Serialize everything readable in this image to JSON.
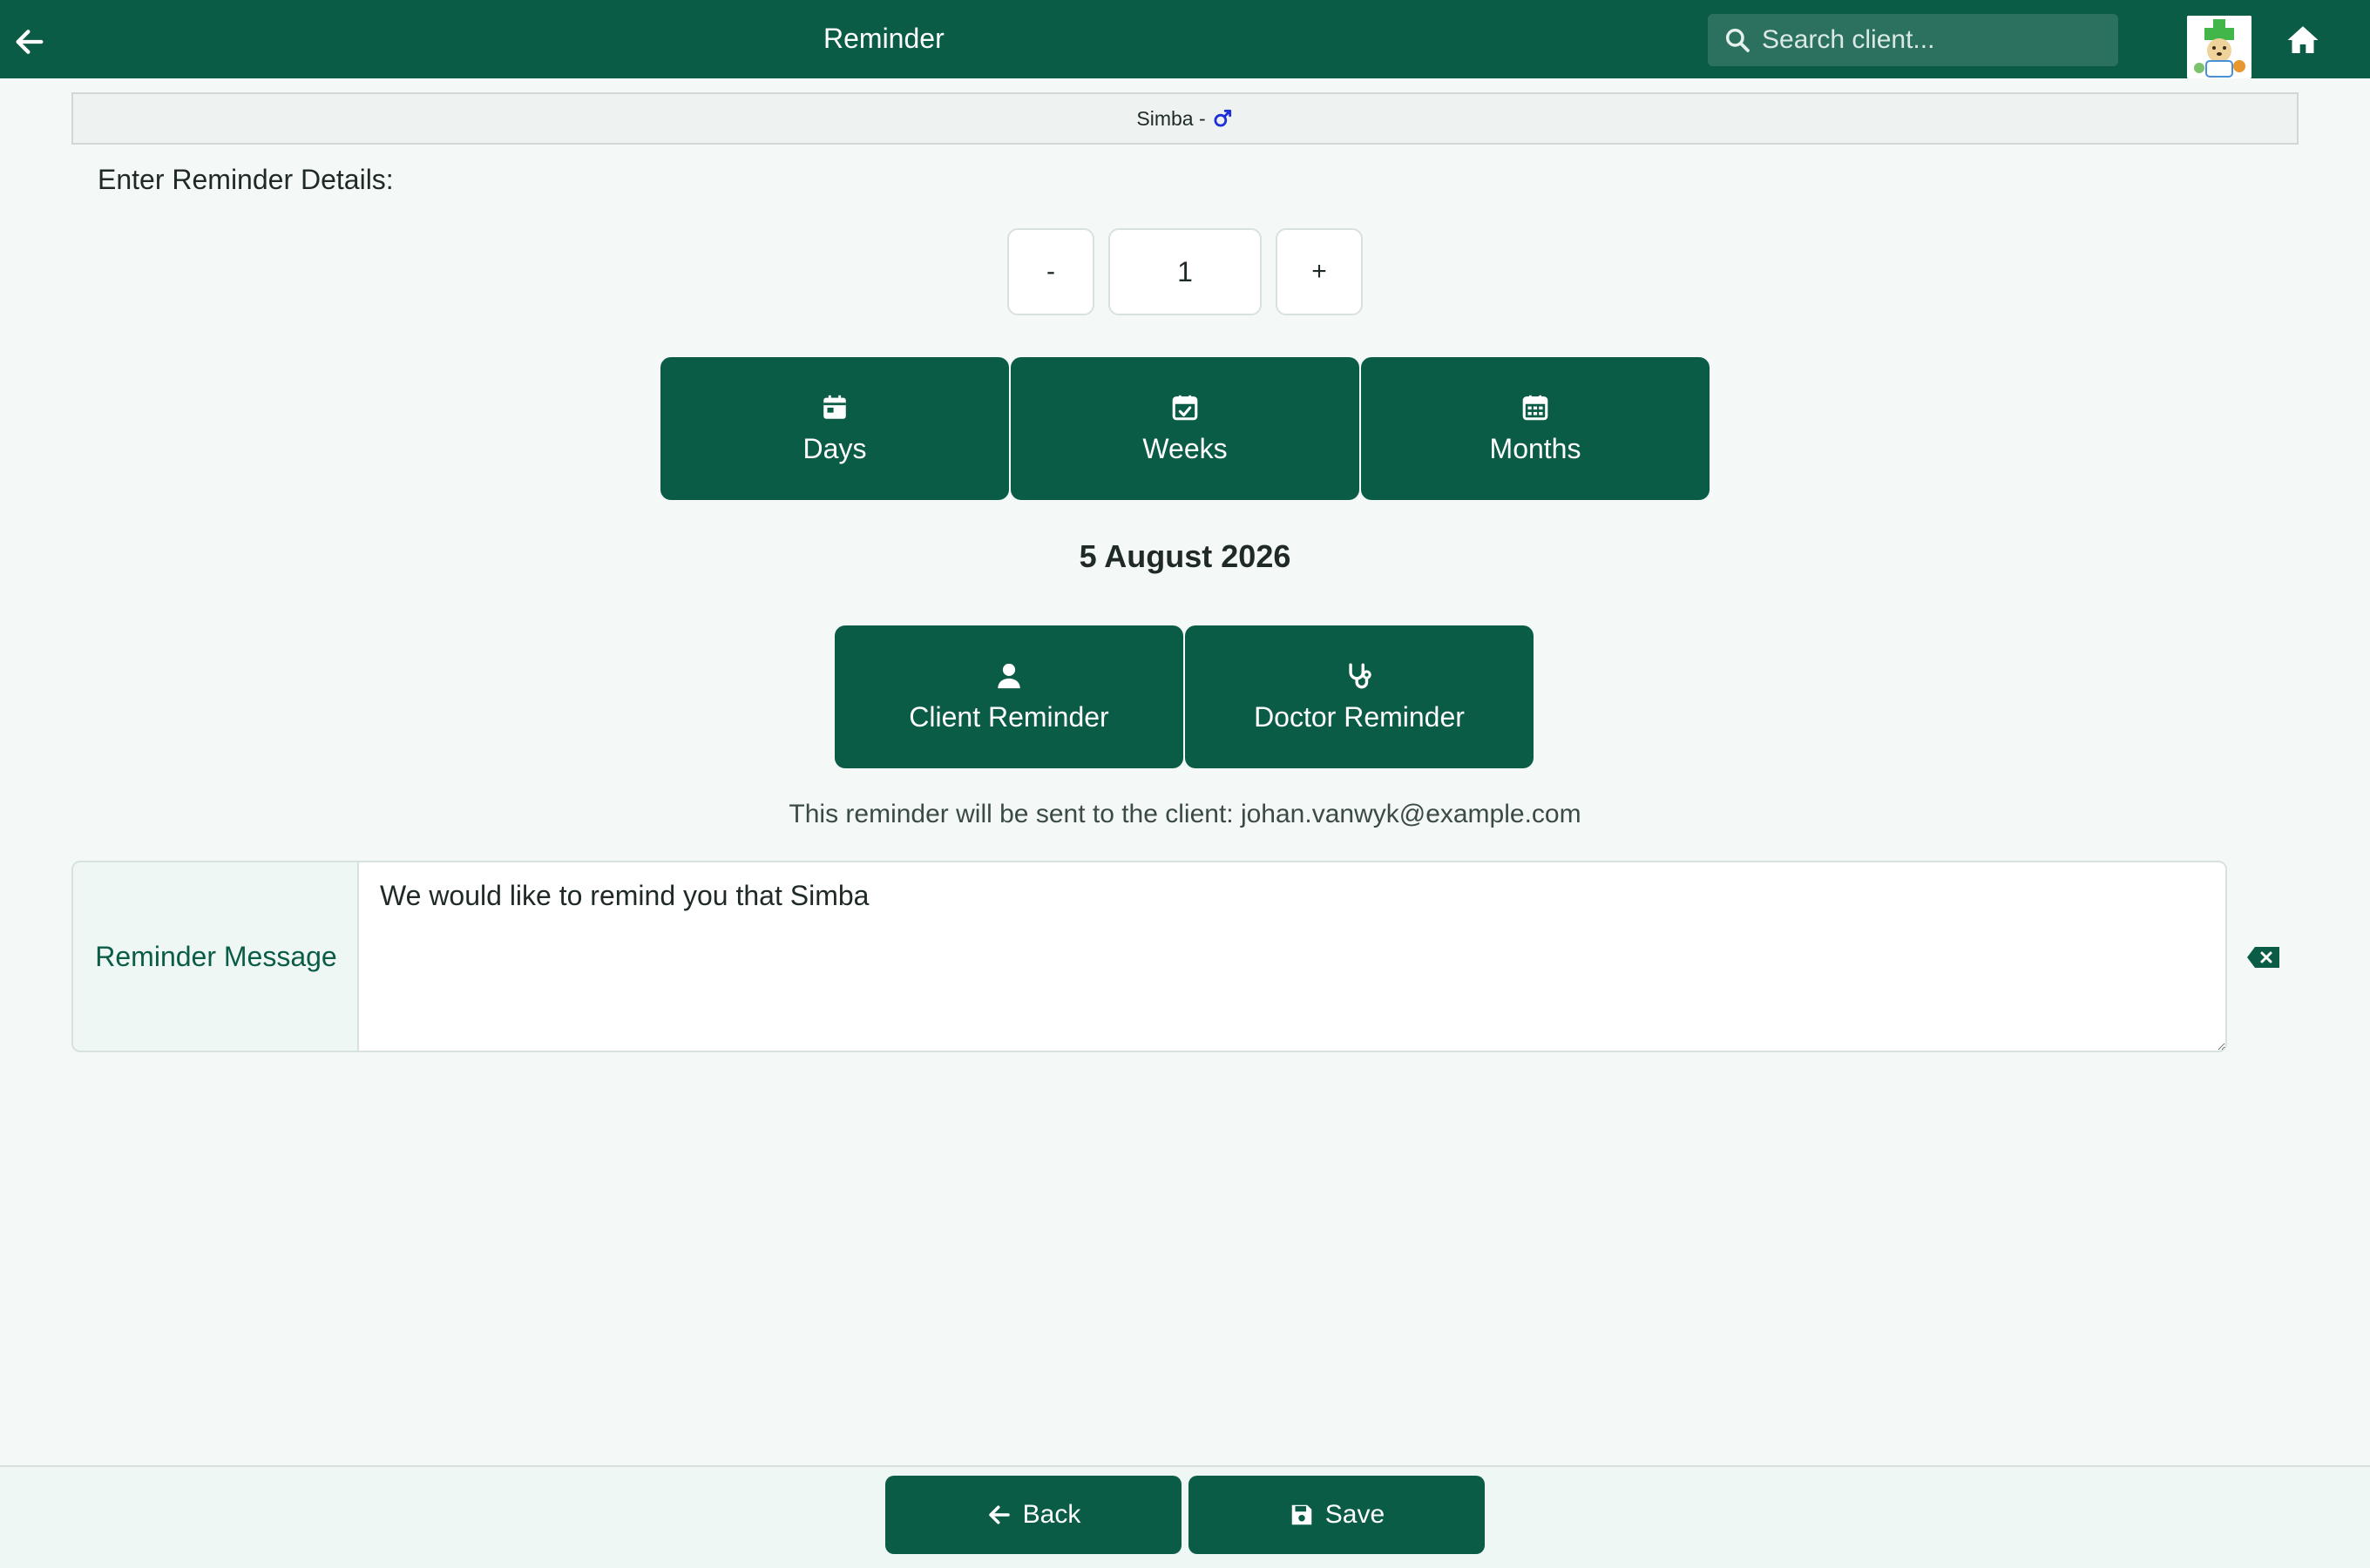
{
  "header": {
    "title": "Reminder",
    "search_placeholder": "Search client...",
    "background_color": "#0b5c47"
  },
  "patient": {
    "name_label": "Simba -",
    "sex_icon": "male-icon"
  },
  "form": {
    "section_label": "Enter Reminder Details:",
    "stepper": {
      "decrement_label": "-",
      "value": "1",
      "increment_label": "+"
    },
    "units": [
      {
        "label": "Days",
        "icon": "calendar-day-icon"
      },
      {
        "label": "Weeks",
        "icon": "calendar-check-icon"
      },
      {
        "label": "Months",
        "icon": "calendar-grid-icon"
      }
    ],
    "date": "5 August 2026",
    "reminder_types": [
      {
        "label": "Client Reminder",
        "icon": "user-icon"
      },
      {
        "label": "Doctor Reminder",
        "icon": "stethoscope-icon"
      }
    ],
    "send_info": "This reminder will be sent to the client: johan.vanwyk@example.com",
    "message_label": "Reminder Message",
    "message_value": "We would like to remind you that Simba"
  },
  "footer": {
    "back_label": "Back",
    "save_label": "Save"
  }
}
